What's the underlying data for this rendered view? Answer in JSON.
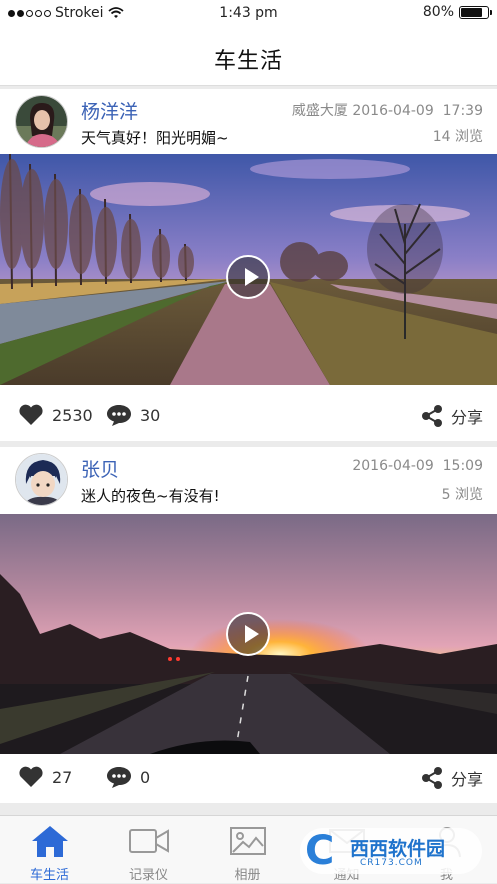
{
  "status_bar": {
    "carrier": "Strokei",
    "time": "1:43 pm",
    "battery": "80%"
  },
  "nav": {
    "title": "车生活"
  },
  "posts": [
    {
      "username": "杨洋洋",
      "caption": "天气真好！阳光明媚~",
      "location_date": "威盛大厦 2016-04-09",
      "time": "17:39",
      "views": "14 浏览",
      "likes": "2530",
      "comments": "30",
      "share_label": "分享"
    },
    {
      "username": "张贝",
      "caption": "迷人的夜色~有没有!",
      "location_date": "2016-04-09",
      "time": "15:09",
      "views": "5 浏览",
      "likes": "27",
      "comments": "0",
      "share_label": "分享"
    }
  ],
  "tabs": [
    {
      "label": "车生活",
      "icon": "home-icon",
      "active": true
    },
    {
      "label": "记录仪",
      "icon": "video-camera-icon",
      "active": false
    },
    {
      "label": "相册",
      "icon": "photo-icon",
      "active": false
    },
    {
      "label": "通知",
      "icon": "mail-icon",
      "active": false
    },
    {
      "label": "我",
      "icon": "person-icon",
      "active": false
    }
  ],
  "colors": {
    "accent": "#2d6ad6",
    "username": "#3c63b6",
    "meta": "#8a8a8a"
  },
  "watermark": {
    "brand": "西西软件园",
    "site": "CR173.COM"
  }
}
